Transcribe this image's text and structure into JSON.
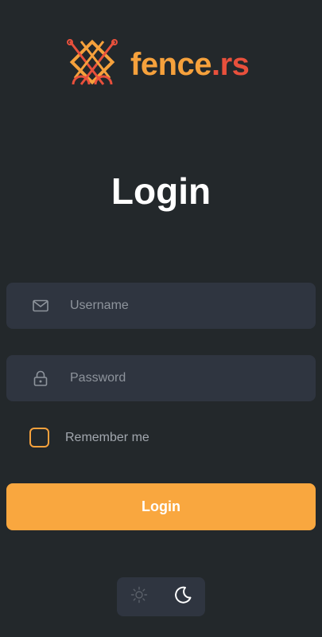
{
  "brand": {
    "name_part1": "fence",
    "name_part2": ".rs",
    "colors": {
      "orange": "#f6a13c",
      "red": "#e8503c"
    }
  },
  "page": {
    "title": "Login"
  },
  "form": {
    "username": {
      "placeholder": "Username",
      "value": "",
      "icon": "mail-icon"
    },
    "password": {
      "placeholder": "Password",
      "value": "",
      "icon": "lock-icon"
    },
    "remember": {
      "label": "Remember me",
      "checked": false
    },
    "submit_label": "Login"
  },
  "theme": {
    "options": [
      {
        "name": "light",
        "icon": "sun-icon",
        "active": false
      },
      {
        "name": "dark",
        "icon": "moon-icon",
        "active": true
      }
    ]
  },
  "colors": {
    "background": "#23282b",
    "field_bg": "#2f3540",
    "accent": "#f9a73f"
  }
}
